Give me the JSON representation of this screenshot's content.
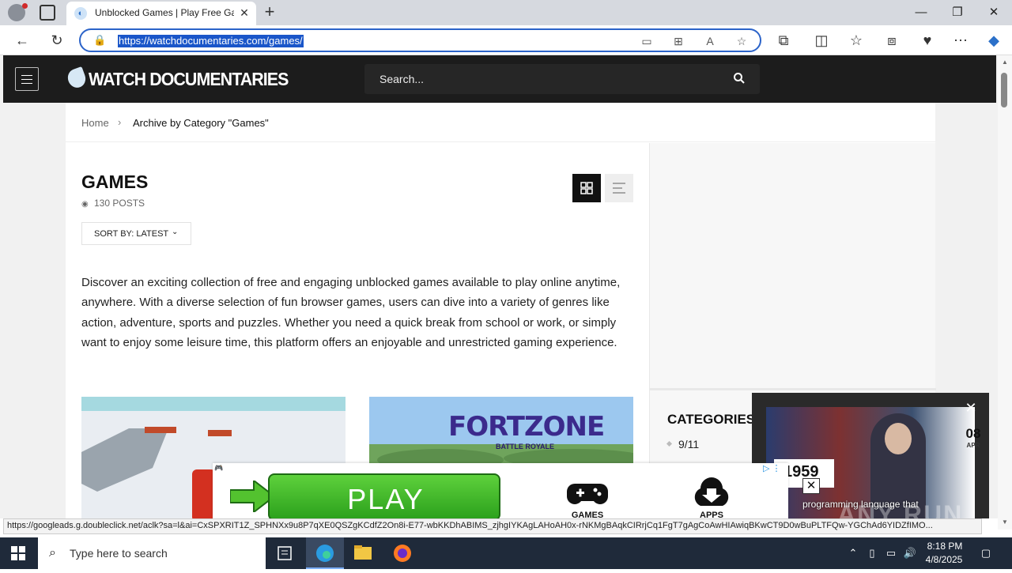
{
  "browser": {
    "tab_title": "Unblocked Games | Play Free Games",
    "url": "https://watchdocumentaries.com/games/"
  },
  "site": {
    "logo_text": "WATCH DOCUMENTARIES",
    "search_placeholder": "Search..."
  },
  "breadcrumb": {
    "home": "Home",
    "separator": "›",
    "current": "Archive by Category \"Games\""
  },
  "page": {
    "title": "GAMES",
    "post_count": "130 POSTS",
    "sort_label": "SORT BY: LATEST",
    "description": "Discover an exciting collection of free and engaging unblocked games available to play online anytime, anywhere. With a diverse selection of fun browser games, users can dive into a variety of genres like action, adventure, sports and puzzles. Whether you need a quick break from school or work, or simply want to enjoy some leisure time, this platform offers an enjoyable and unrestricted gaming experience."
  },
  "thumbnails": [
    {
      "title": ""
    },
    {
      "title": "FORTZONE",
      "subtitle": "BATTLE ROYALE"
    }
  ],
  "sidebar": {
    "categories_title": "CATEGORIES",
    "items": [
      "9/11"
    ]
  },
  "ad_banner": {
    "play_label": "PLAY",
    "games_label": "GAMES",
    "apps_label": "APPS"
  },
  "video_ad": {
    "day": "08",
    "month": "APR",
    "year": "1959",
    "caption": "programming language that",
    "watermark": "ANY RUN"
  },
  "status_bar": {
    "text": "https://googleads.g.doubleclick.net/aclk?sa=l&ai=CxSPXRIT1Z_SPHNXx9u8P7qXE0QSZgKCdfZ2On8i-E77-wbKKDhABIMS_zjhgIYKAgLAHoAH0x-rNKMgBAqkCIRrjCq1FgT7gAgCoAwHIAwiqBKwCT9D0wBuPLTFQw-YGChAd6YIDZfIMO..."
  },
  "taskbar": {
    "search_placeholder": "Type here to search",
    "time": "8:18 PM",
    "date": "4/8/2025"
  },
  "colors": {
    "site_header": "#1c1c1c",
    "address_border": "#2b63c9",
    "play_green": "#3bb526",
    "taskbar": "#1f2a3a"
  }
}
